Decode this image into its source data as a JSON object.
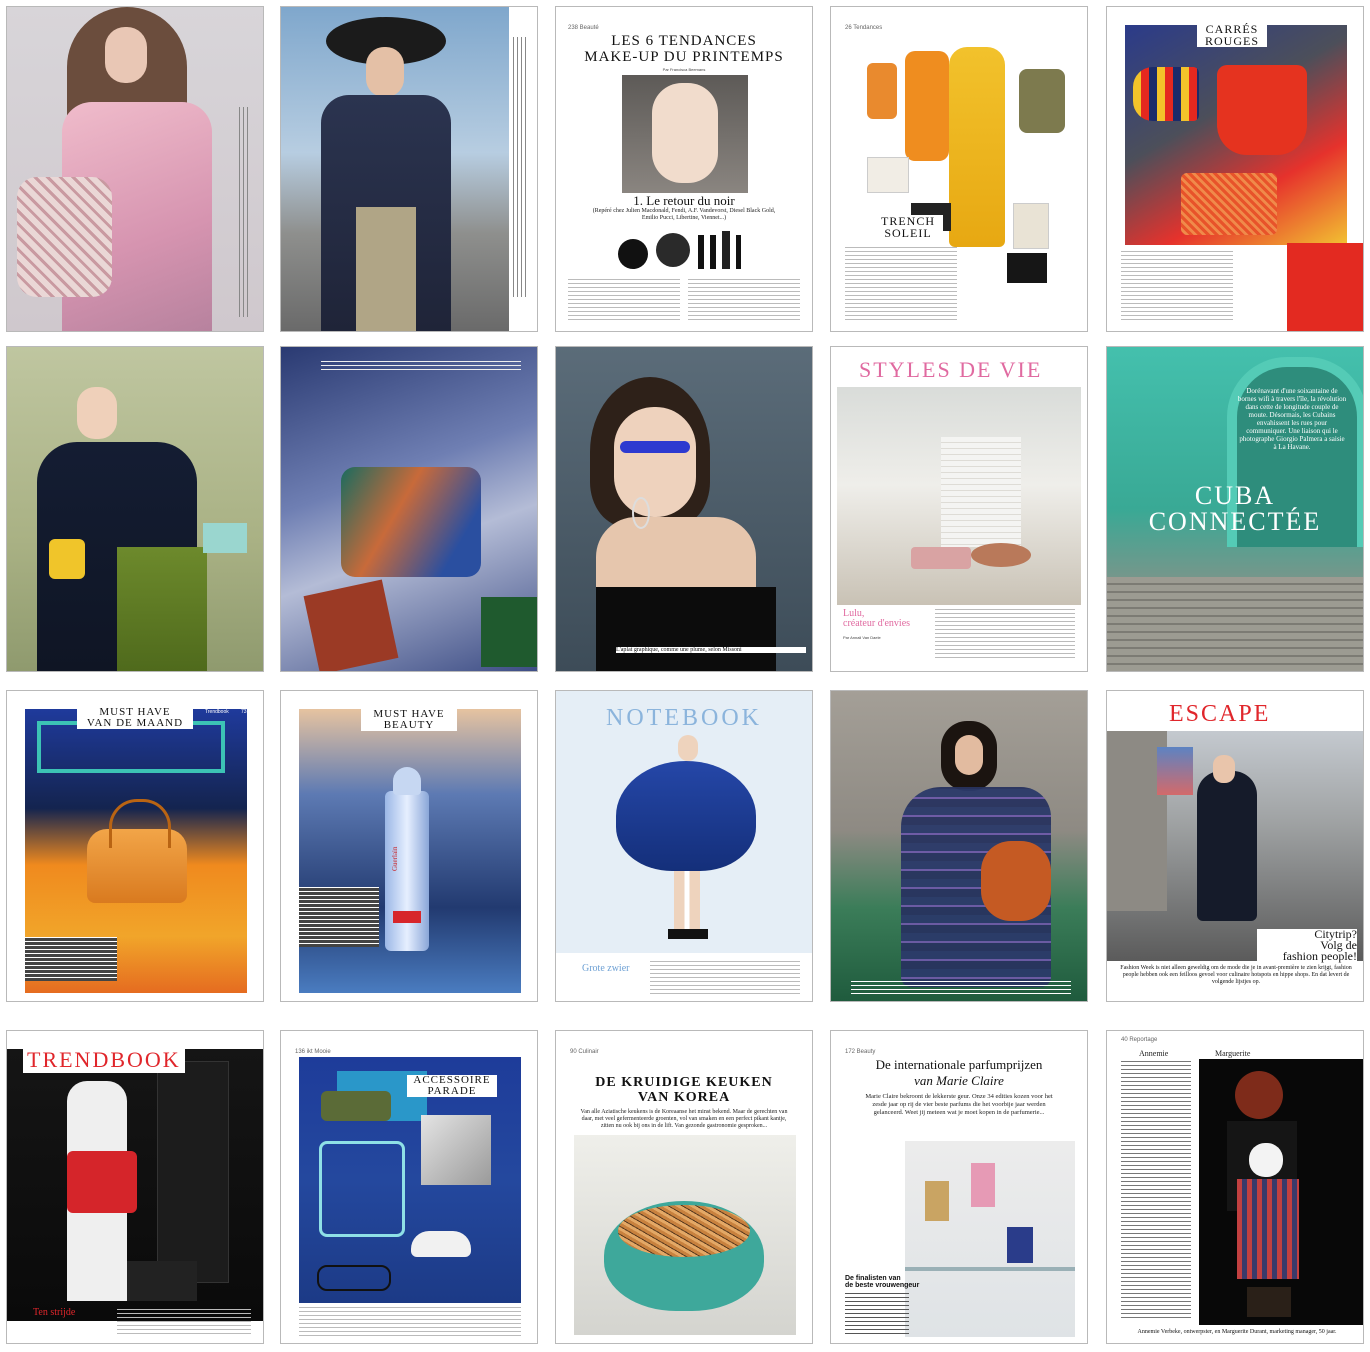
{
  "pages": {
    "p3": {
      "page_no": "238 Beauté",
      "title": "LES 6 TENDANCES\nMAKE-UP DU PRINTEMPS",
      "byline": "Par Francisca Beemans",
      "subtitle": "1. Le retour du noir",
      "subdesc": "(Repéré chez Julien Macdonald, Fendi, A.F. Vandevorst, Diesel Black Gold, Emilio Pucci, Libertine, Viennet...)"
    },
    "p4": {
      "page_no": "26 Tendances",
      "title": "TRENCH\nSOLEIL"
    },
    "p5": {
      "title": "CARRÉS\nROUGES"
    },
    "p9": {
      "title": "STYLES DE VIE",
      "subtitle": "Lulu,\ncréateur d'envies",
      "byline": "Par Annali Van Daele"
    },
    "p10": {
      "title": "CUBA\nCONNECTÉE",
      "intro": "Dorénavant d'une soixantaine de bornes wifi à travers l'île, la révolution dans cette de longitude couple de moute. Désormais, les Cubains envahissent les rues pour communiquer. Une liaison qui le photographe Giorgio Palmera a saisie à La Havane."
    },
    "p8": {
      "caption": "L'aplat graphique, comme une plume, selon Missoni"
    },
    "p11": {
      "title": "MUST HAVE\nVAN DE MAAND",
      "section": "Trendbook",
      "page_no": "73"
    },
    "p12": {
      "title": "MUST HAVE\nBEAUTY",
      "brand": "Guerlain"
    },
    "p13": {
      "title": "NOTEBOOK",
      "subtitle": "Grote zwier"
    },
    "p15": {
      "title": "ESCAPE",
      "subtitle": "Citytrip?\nVolg de\nfashion people!",
      "text": "Fashion Week is niet alleen geweldig om de mode die je in avant-première te zien krijgt, fashion people hebben ook een feilloos gevoel voor culinaire hotspots en hippe shops. En dat levert de volgende lijstjes op."
    },
    "p16": {
      "title": "TRENDBOOK",
      "subtitle": "Ten strijde"
    },
    "p17": {
      "page_no": "136 ikt Mooie",
      "title": "ACCESSOIRE\nPARADE"
    },
    "p18": {
      "page_no": "90 Culinair",
      "title": "DE KRUIDIGE KEUKEN\nVAN KOREA",
      "intro": "Van alle Aziatische keukens is de Koreaanse het minst bekend. Maar de gerechten van daar, met veel gefermenteerde groenten, vol van smaken en een perfect pikant kantje, zitten nu ook bij ons in de lift. Van gezonde gastronomie gesproken..."
    },
    "p19": {
      "page_no": "172 Beauty",
      "title": "De internationale parfumprijzen",
      "title2": "van Marie Claire",
      "intro": "Marie Claire bekroont de lekkerste geur. Onze 34 edities kozen voor het zesde jaar op rij de vier beste parfums die het voorbije jaar werden gelanceerd. Weet jij meteen wat je moet kopen in de parfumerie...",
      "list_title": "De finalisten van\nde beste vrouwengeur"
    },
    "p20": {
      "page_no": "40 Reportage",
      "name_left": "Annemie",
      "name_right": "Marguerite",
      "caption": "Annemie Verbeke, ontwerpster, en Marguerite Durant, marketing manager, 50 jaar."
    }
  },
  "colors": {
    "accent_red": "#e0262b",
    "pink": "#e06aa0",
    "light_blue": "#8bb4dc",
    "cuba_green": "#3fb59f"
  }
}
